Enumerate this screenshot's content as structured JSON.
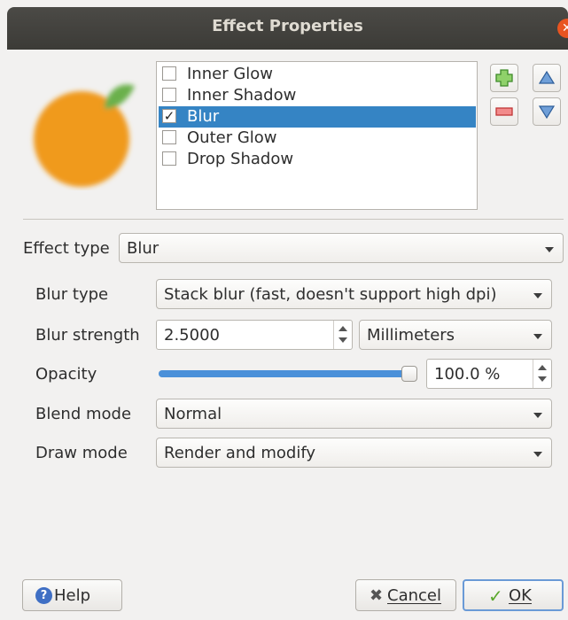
{
  "window": {
    "title": "Effect Properties",
    "close_icon": "close-icon"
  },
  "effects": {
    "items": [
      {
        "label": "Inner Glow",
        "checked": false,
        "selected": false
      },
      {
        "label": "Inner Shadow",
        "checked": false,
        "selected": false
      },
      {
        "label": "Blur",
        "checked": true,
        "selected": true
      },
      {
        "label": "Outer Glow",
        "checked": false,
        "selected": false
      },
      {
        "label": "Drop Shadow",
        "checked": false,
        "selected": false
      }
    ],
    "check_mark": "✓"
  },
  "effect_type": {
    "label": "Effect type",
    "value": "Blur"
  },
  "form": {
    "blur_type_label": "Blur type",
    "blur_type_value": "Stack blur (fast, doesn't support high dpi)",
    "blur_strength_label": "Blur strength",
    "blur_strength_value": "2.5000",
    "unit_value": "Millimeters",
    "opacity_label": "Opacity",
    "opacity_value": "100.0 %",
    "opacity_fraction": 1.0,
    "blend_mode_label": "Blend mode",
    "blend_mode_value": "Normal",
    "draw_mode_label": "Draw mode",
    "draw_mode_value": "Render and modify"
  },
  "buttons": {
    "help": "Help",
    "cancel": "Cancel",
    "ok": "OK"
  },
  "colors": {
    "selection": "#3584c4",
    "accent": "#e95420",
    "slider": "#4a90d9"
  }
}
